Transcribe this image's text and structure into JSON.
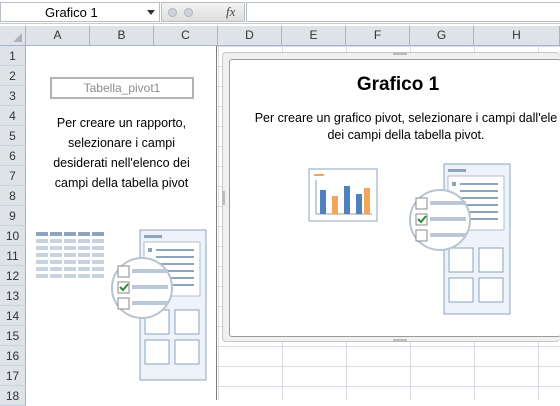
{
  "formula_bar": {
    "name_box": "Grafico 1",
    "fx_label": "fx",
    "formula": ""
  },
  "columns": [
    "A",
    "B",
    "C",
    "D",
    "E",
    "F",
    "G",
    "H"
  ],
  "rows": [
    "1",
    "2",
    "3",
    "4",
    "5",
    "6",
    "7",
    "8",
    "9",
    "10",
    "11",
    "12",
    "13",
    "14",
    "15",
    "16",
    "17",
    "18"
  ],
  "pivot_table": {
    "name": "Tabella_pivot1",
    "instruction_lines": [
      "Per creare un rapporto,",
      "selezionare i campi",
      "desiderati nell'elenco dei",
      "campi della tabella pivot"
    ]
  },
  "chart": {
    "title": "Grafico 1",
    "instruction_lines": [
      "Per creare un grafico pivot, selezionare i campi dall'ele",
      "dei campi della tabella pivot."
    ]
  },
  "colors": {
    "header_bg": "#dfe3e8",
    "gridline": "#d9dde3",
    "accent_blue": "#4f81bd",
    "accent_orange": "#f2a65a",
    "checkbox_green": "#2e8b3a"
  }
}
